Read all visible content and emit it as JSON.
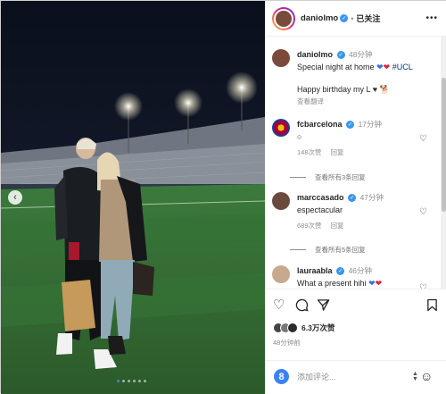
{
  "post": {
    "username": "daniolmo",
    "follow_state": "已关注",
    "separator": "•",
    "more": "•••",
    "photo_dots": 6,
    "active_dot": 0
  },
  "caption": {
    "username": "daniolmo",
    "time": "48分钟",
    "line1": "Special night at home",
    "hashtag": "#UCL",
    "line2": "Happy birthday my L",
    "translate": "查看翻译"
  },
  "comments": [
    {
      "username": "fcbarcelona",
      "time": "17分钟",
      "text": "○",
      "likes": "148次赞",
      "reply": "回复",
      "view_replies": "查看所有3条回复"
    },
    {
      "username": "marccasado",
      "time": "47分钟",
      "text": "espectacular",
      "likes": "689次赞",
      "reply": "回复",
      "view_replies": "查看所有5条回复"
    },
    {
      "username": "lauraabla",
      "time": "46分钟",
      "text": "What a present hihi"
    }
  ],
  "actions": {
    "like_icon": "heart-icon",
    "comment_icon": "comment-icon",
    "share_icon": "send-icon",
    "save_icon": "bookmark-icon"
  },
  "stats": {
    "likes": "6.3万次赞",
    "posted": "48分钟前"
  },
  "composer": {
    "placeholder": "添加评论..."
  },
  "colors": {
    "verified": "#3897f0",
    "link": "#00376b",
    "muted": "#8e8e8e",
    "heart_blue": "#3b6fd6",
    "heart_red": "#e0223a"
  }
}
